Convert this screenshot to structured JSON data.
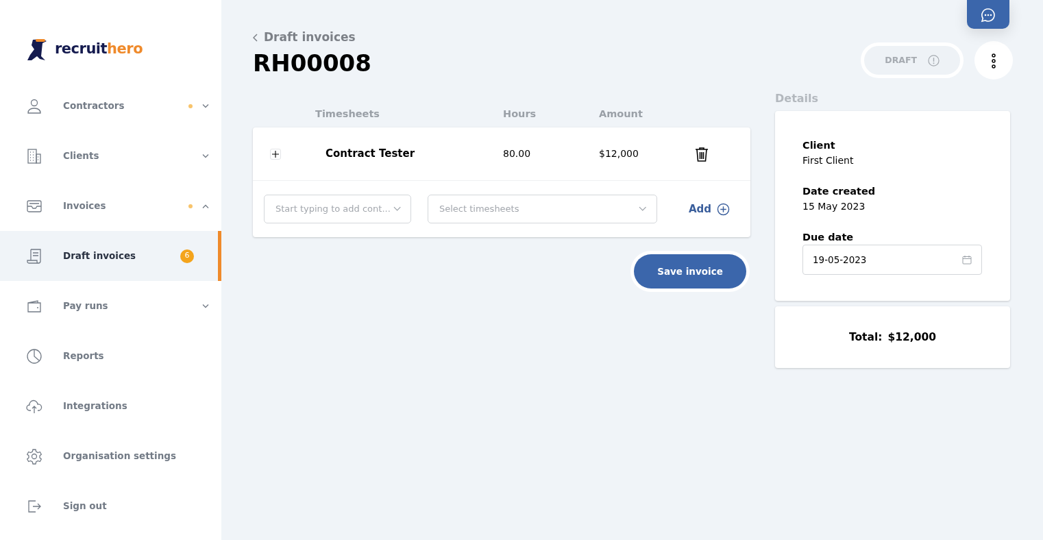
{
  "logo": {
    "part_1": "recruit",
    "part_2": "hero"
  },
  "sidebar": {
    "items": [
      {
        "label": "Contractors",
        "selected": false,
        "alert": true,
        "expanded": false
      },
      {
        "label": "Clients",
        "selected": false,
        "alert": false,
        "expanded": false
      },
      {
        "label": "Invoices",
        "selected": false,
        "alert": true,
        "expanded": true
      },
      {
        "label": "Draft invoices",
        "selected": true,
        "alert": false,
        "badge": "6"
      },
      {
        "label": "Pay runs",
        "selected": false,
        "alert": false,
        "expanded": false
      },
      {
        "label": "Reports",
        "selected": false,
        "alert": false
      },
      {
        "label": "Integrations",
        "selected": false,
        "alert": false
      },
      {
        "label": "Organisation settings",
        "selected": false,
        "alert": false
      },
      {
        "label": "Sign out",
        "selected": false,
        "alert": false
      }
    ]
  },
  "header": {
    "back_link": "Draft invoices",
    "title": "RH00008",
    "status": "DRAFT"
  },
  "table": {
    "columns": [
      "Timesheets",
      "Hours",
      "Amount"
    ],
    "rows": [
      {
        "name": "Contract Tester",
        "hours": "80.00",
        "amount": "$12,000"
      }
    ],
    "contractor_field": {
      "placeholder": "Start typing to add cont..."
    },
    "timesheets_field": {
      "placeholder": "Select timesheets"
    },
    "add_button": "Add"
  },
  "save_button": "Save invoice",
  "details": {
    "heading": "Details",
    "fields": [
      {
        "label": "Client",
        "value": "First Client"
      },
      {
        "label": "Date created",
        "value": "15 May 2023"
      }
    ],
    "due_date": {
      "label": "Due date",
      "value": "19-05-2023"
    },
    "total_label": "Total:",
    "total_value": "$12,000"
  }
}
